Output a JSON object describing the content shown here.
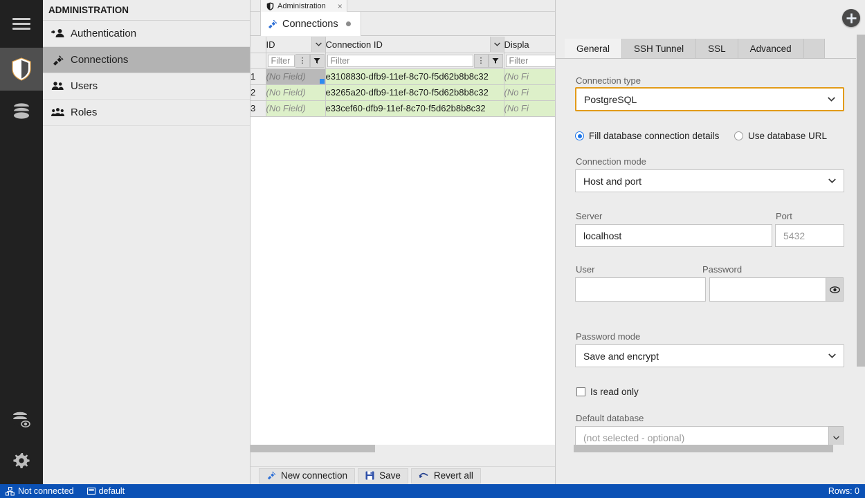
{
  "rail": {
    "items": [
      {
        "name": "menu-icon",
        "label": "Menu",
        "active": false
      },
      {
        "name": "shield-icon",
        "label": "Administration",
        "active": true
      },
      {
        "name": "database-icon",
        "label": "Databases",
        "active": false
      },
      {
        "name": "database-view-icon",
        "label": "Database viewer",
        "active": false
      },
      {
        "name": "gear-icon",
        "label": "Settings",
        "active": false
      }
    ]
  },
  "sidebar": {
    "title": "ADMINISTRATION",
    "items": [
      {
        "label": "Authentication",
        "icon": "authentication-icon",
        "selected": false
      },
      {
        "label": "Connections",
        "icon": "plug-icon",
        "selected": true
      },
      {
        "label": "Users",
        "icon": "users-icon",
        "selected": false
      },
      {
        "label": "Roles",
        "icon": "roles-icon",
        "selected": false
      }
    ]
  },
  "tabs": {
    "outer": {
      "label": "Administration",
      "icon": "shield-icon",
      "close": "×"
    },
    "inner": {
      "label": "Connections",
      "icon": "plug-icon",
      "modified": true
    }
  },
  "grid": {
    "columns": [
      {
        "key": "sel",
        "label": ""
      },
      {
        "key": "id",
        "label": "ID"
      },
      {
        "key": "connection_id",
        "label": "Connection ID"
      },
      {
        "key": "display",
        "label": "Displa"
      }
    ],
    "filter_placeholder": "Filter",
    "rows": [
      {
        "num": "1",
        "id": "(No Field)",
        "connection_id": "e3108830-dfb9-11ef-8c70-f5d62b8b8c32",
        "display": "(No Fi",
        "selected": true
      },
      {
        "num": "2",
        "id": "(No Field)",
        "connection_id": "e3265a20-dfb9-11ef-8c70-f5d62b8b8c32",
        "display": "(No Fi",
        "selected": false
      },
      {
        "num": "3",
        "id": "(No Field)",
        "connection_id": "e33cef60-dfb9-11ef-8c70-f5d62b8b8c32",
        "display": "(No Fi",
        "selected": false
      }
    ]
  },
  "toolbar": {
    "new_connection": "New connection",
    "save": "Save",
    "revert_all": "Revert all"
  },
  "form": {
    "tabs": [
      {
        "label": "General",
        "active": true
      },
      {
        "label": "SSH Tunnel",
        "active": false
      },
      {
        "label": "SSL",
        "active": false
      },
      {
        "label": "Advanced",
        "active": false
      }
    ],
    "connection_type": {
      "label": "Connection type",
      "value": "PostgreSQL"
    },
    "mode_radio": {
      "fill": "Fill database connection details",
      "url": "Use database URL",
      "selected": "fill"
    },
    "connection_mode": {
      "label": "Connection mode",
      "value": "Host and port"
    },
    "server": {
      "label": "Server",
      "value": "localhost"
    },
    "port": {
      "label": "Port",
      "placeholder": "5432",
      "value": ""
    },
    "user": {
      "label": "User",
      "value": ""
    },
    "password": {
      "label": "Password",
      "value": "",
      "toggle_icon": "eye-icon"
    },
    "password_mode": {
      "label": "Password mode",
      "value": "Save and encrypt"
    },
    "is_read_only": {
      "label": "Is read only",
      "checked": false
    },
    "default_database": {
      "label": "Default database",
      "placeholder": "(not selected - optional)",
      "value": ""
    }
  },
  "statusbar": {
    "connection": "Not connected",
    "database": "default",
    "rows": "Rows: 0"
  },
  "colors": {
    "accent_blue": "#0b51b5",
    "highlight_orange": "#e29b19",
    "row_green": "#ddf0c9",
    "radio_blue": "#1a73e8"
  }
}
